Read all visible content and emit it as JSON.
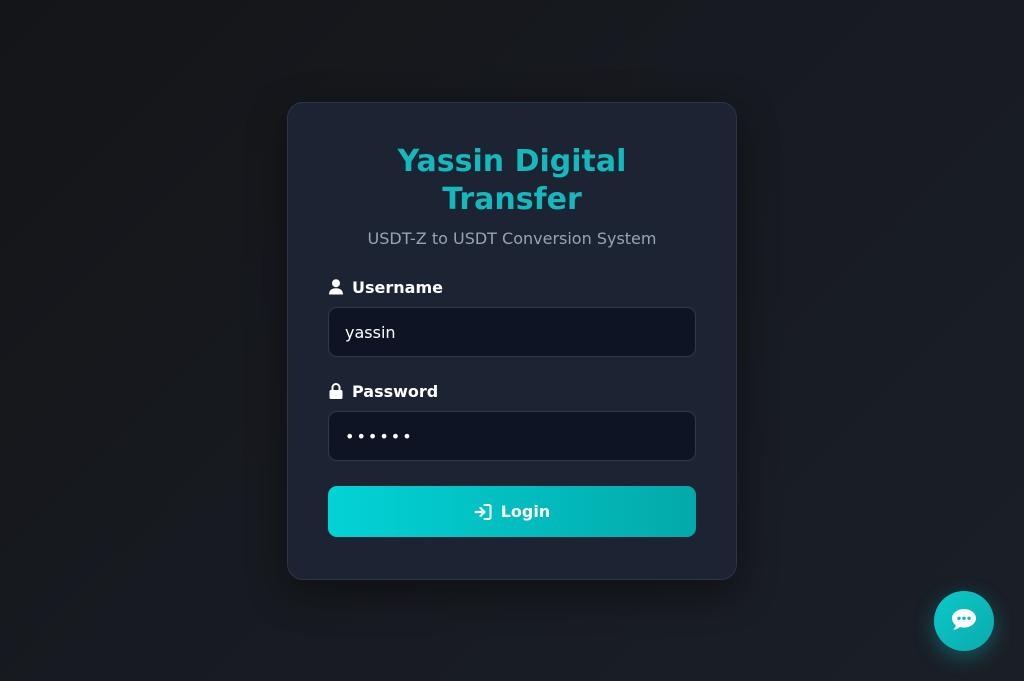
{
  "app": {
    "title": "Yassin Digital Transfer",
    "subtitle": "USDT-Z to USDT Conversion System"
  },
  "form": {
    "username": {
      "label": "Username",
      "value": "yassin",
      "icon": "user-icon"
    },
    "password": {
      "label": "Password",
      "value": "••••••",
      "icon": "lock-icon"
    },
    "login_button": {
      "label": "Login",
      "icon": "sign-in-icon"
    }
  },
  "chat": {
    "icon": "chat-bubble-icon"
  },
  "colors": {
    "accent": "#15b8bd",
    "card_bg": "#1c2433",
    "input_bg": "#0e1424",
    "button_start": "#02d3d6",
    "button_end": "#03a9aa"
  }
}
